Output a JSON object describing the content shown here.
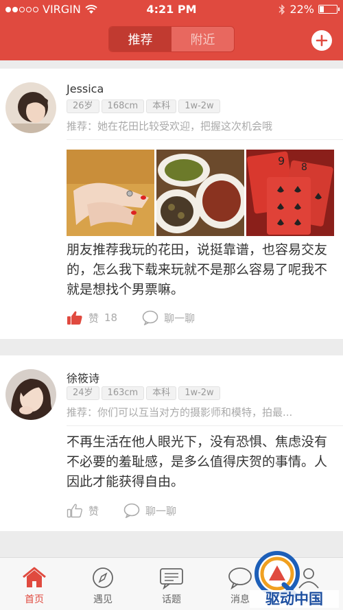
{
  "status_bar": {
    "carrier": "VIRGIN",
    "time": "4:21 PM",
    "battery": "22%",
    "battery_level": 0.22
  },
  "header": {
    "tabs": [
      {
        "label": "推荐",
        "active": true
      },
      {
        "label": "附近",
        "active": false
      }
    ],
    "add_icon": "plus-circle-icon"
  },
  "posts": [
    {
      "name": "Jessica",
      "tags": [
        "26岁",
        "168cm",
        "本科",
        "1w-2w"
      ],
      "recommend": "推荐：她在花田比较受欢迎，把握这次机会哦",
      "photos": [
        "hands-with-rings-photo",
        "food-dishes-photo",
        "playing-cards-photo"
      ],
      "text": "朋友推荐我玩的花田，说挺靠谱，也容易交友的，怎么我下载来玩就不是那么容易了呢我不就是想找个男票嘛。",
      "like_label": "赞",
      "like_count": "18",
      "liked": true,
      "chat_label": "聊一聊"
    },
    {
      "name": "徐筱诗",
      "tags": [
        "24岁",
        "163cm",
        "本科",
        "1w-2w"
      ],
      "recommend": "推荐：你们可以互当对方的摄影师和模特，拍最...",
      "text": "不再生活在他人眼光下，没有恐惧、焦虑没有不必要的羞耻感，是多么值得庆贺的事情。人因此才能获得自由。",
      "like_label": "赞",
      "liked": false,
      "chat_label": "聊一聊"
    }
  ],
  "tabbar": {
    "items": [
      {
        "label": "首页",
        "icon": "home-icon",
        "active": true
      },
      {
        "label": "遇见",
        "icon": "compass-icon",
        "active": false
      },
      {
        "label": "话题",
        "icon": "topic-chat-icon",
        "active": false
      },
      {
        "label": "消息",
        "icon": "message-bubble-icon",
        "active": false
      },
      {
        "label": "我",
        "icon": "profile-icon",
        "active": false
      }
    ]
  },
  "watermark": {
    "text": "驱动中国"
  },
  "colors": {
    "accent": "#e04a3f",
    "muted": "#aaaaaa"
  }
}
